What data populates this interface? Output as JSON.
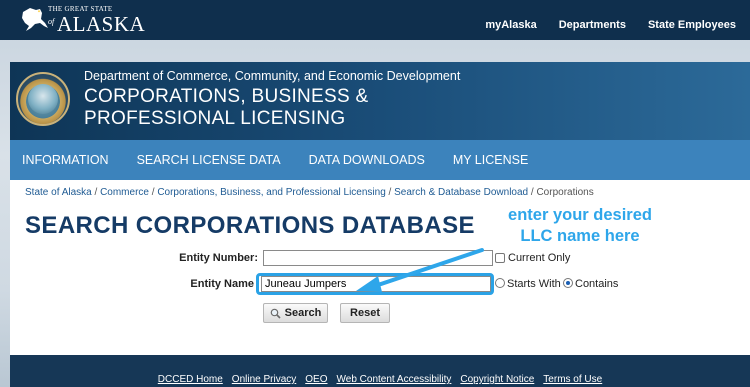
{
  "site": {
    "logo_text_small": "THE GREAT STATE",
    "logo_text_of": "of",
    "logo_text_main": "ALASKA",
    "top_nav": [
      "myAlaska",
      "Departments",
      "State Employees"
    ]
  },
  "header": {
    "department": "Department of Commerce, Community, and Economic Development",
    "division": "CORPORATIONS, BUSINESS & PROFESSIONAL LICENSING"
  },
  "main_nav": [
    "INFORMATION",
    "SEARCH LICENSE DATA",
    "DATA DOWNLOADS",
    "MY LICENSE"
  ],
  "breadcrumb": {
    "items": [
      "State of Alaska",
      "Commerce",
      "Corporations, Business, and Professional Licensing",
      "Search & Database Download"
    ],
    "separator": " / ",
    "current": "Corporations"
  },
  "page": {
    "title": "SEARCH CORPORATIONS DATABASE"
  },
  "form": {
    "entity_number_label": "Entity Number:",
    "entity_number_value": "",
    "current_only_label": "Current Only",
    "entity_name_label": "Entity Name",
    "entity_name_value": "Juneau Jumpers",
    "starts_with_label": "Starts With",
    "contains_label": "Contains",
    "selected_match": "Contains",
    "search_button": "Search",
    "reset_button": "Reset"
  },
  "annotation": {
    "line1": "enter your desired",
    "line2": "LLC name here",
    "color": "#2ea6ea"
  },
  "footer": {
    "links": [
      "DCCED Home",
      "Online Privacy",
      "OEO",
      "Web Content Accessibility",
      "Copyright Notice",
      "Terms of Use"
    ]
  },
  "colors": {
    "top_bar": "#0f2f4d",
    "nav_bar": "#3c83bc",
    "title": "#153b66",
    "footer": "#163756"
  }
}
